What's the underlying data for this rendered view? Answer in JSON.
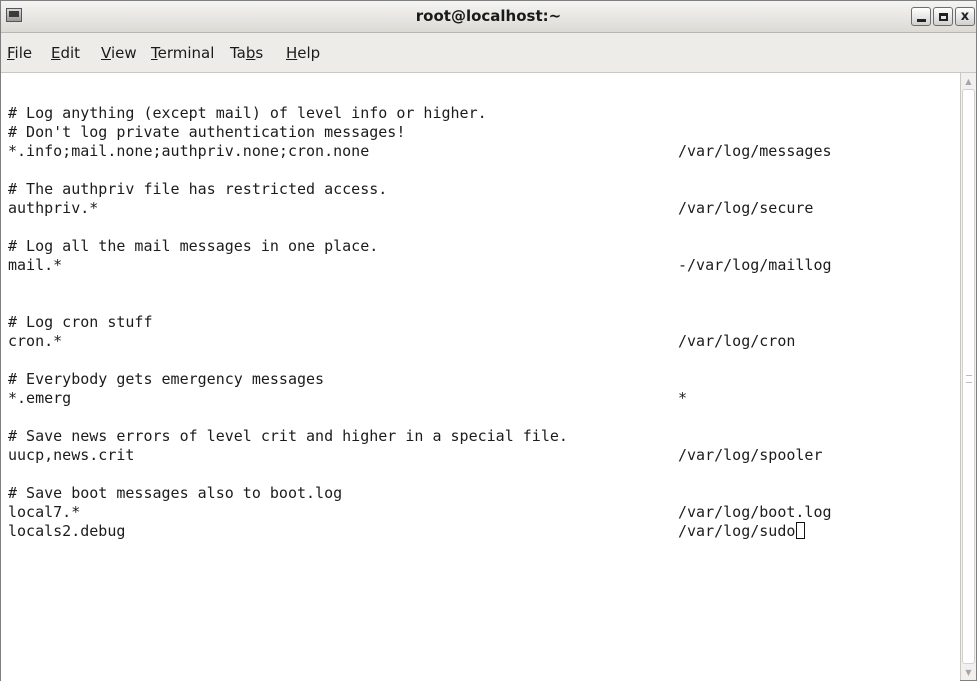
{
  "window": {
    "title": "root@localhost:~",
    "icon": "terminal-icon",
    "controls": {
      "minimize": "minimize-icon",
      "maximize": "maximize-icon",
      "close_label": "x"
    }
  },
  "menu": [
    {
      "pre": "",
      "u": "F",
      "post": "ile"
    },
    {
      "pre": "",
      "u": "E",
      "post": "dit"
    },
    {
      "pre": "",
      "u": "V",
      "post": "iew"
    },
    {
      "pre": "",
      "u": "T",
      "post": "erminal"
    },
    {
      "pre": "Ta",
      "u": "b",
      "post": "s"
    },
    {
      "pre": "",
      "u": "H",
      "post": "elp"
    }
  ],
  "terminal": {
    "lines": [
      {
        "c1": "# Log anything (except mail) of level info or higher.",
        "c2": ""
      },
      {
        "c1": "# Don't log private authentication messages!",
        "c2": ""
      },
      {
        "c1": "*.info;mail.none;authpriv.none;cron.none",
        "c2": "/var/log/messages"
      },
      {
        "c1": "",
        "c2": ""
      },
      {
        "c1": "# The authpriv file has restricted access.",
        "c2": ""
      },
      {
        "c1": "authpriv.*",
        "c2": "/var/log/secure"
      },
      {
        "c1": "",
        "c2": ""
      },
      {
        "c1": "# Log all the mail messages in one place.",
        "c2": ""
      },
      {
        "c1": "mail.*",
        "c2": "-/var/log/maillog"
      },
      {
        "c1": "",
        "c2": ""
      },
      {
        "c1": "",
        "c2": ""
      },
      {
        "c1": "# Log cron stuff",
        "c2": ""
      },
      {
        "c1": "cron.*",
        "c2": "/var/log/cron"
      },
      {
        "c1": "",
        "c2": ""
      },
      {
        "c1": "# Everybody gets emergency messages",
        "c2": ""
      },
      {
        "c1": "*.emerg",
        "c2": "*"
      },
      {
        "c1": "",
        "c2": ""
      },
      {
        "c1": "# Save news errors of level crit and higher in a special file.",
        "c2": ""
      },
      {
        "c1": "uucp,news.crit",
        "c2": "/var/log/spooler"
      },
      {
        "c1": "",
        "c2": ""
      },
      {
        "c1": "# Save boot messages also to boot.log",
        "c2": ""
      },
      {
        "c1": "local7.*",
        "c2": "/var/log/boot.log"
      },
      {
        "c1": "locals2.debug",
        "c2": "/var/log/sudo"
      }
    ],
    "cursor_line": 22
  },
  "scrollbar": {
    "position": 0.5
  }
}
